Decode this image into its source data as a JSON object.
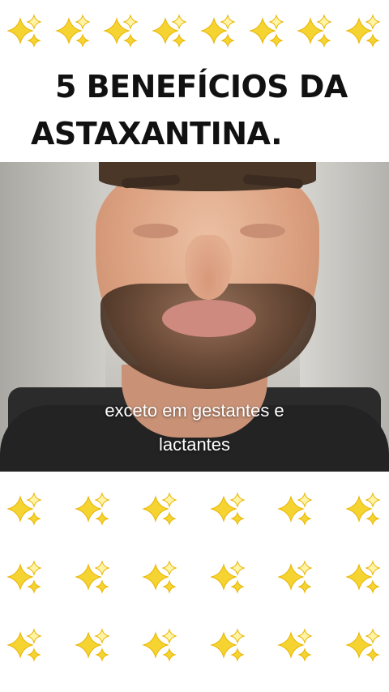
{
  "title": {
    "line1": "5 BENEFÍCIOS DA",
    "line2": "ASTAXANTINA."
  },
  "video": {
    "caption_line1": "exceto em gestantes e",
    "caption_line2": "lactantes"
  },
  "decoration": {
    "icon": "sparkles-icon",
    "colors": {
      "sparkle": "#f5d431",
      "sparkle_outline": "#e8b400",
      "sparkle_small": "#fff3a6"
    }
  }
}
